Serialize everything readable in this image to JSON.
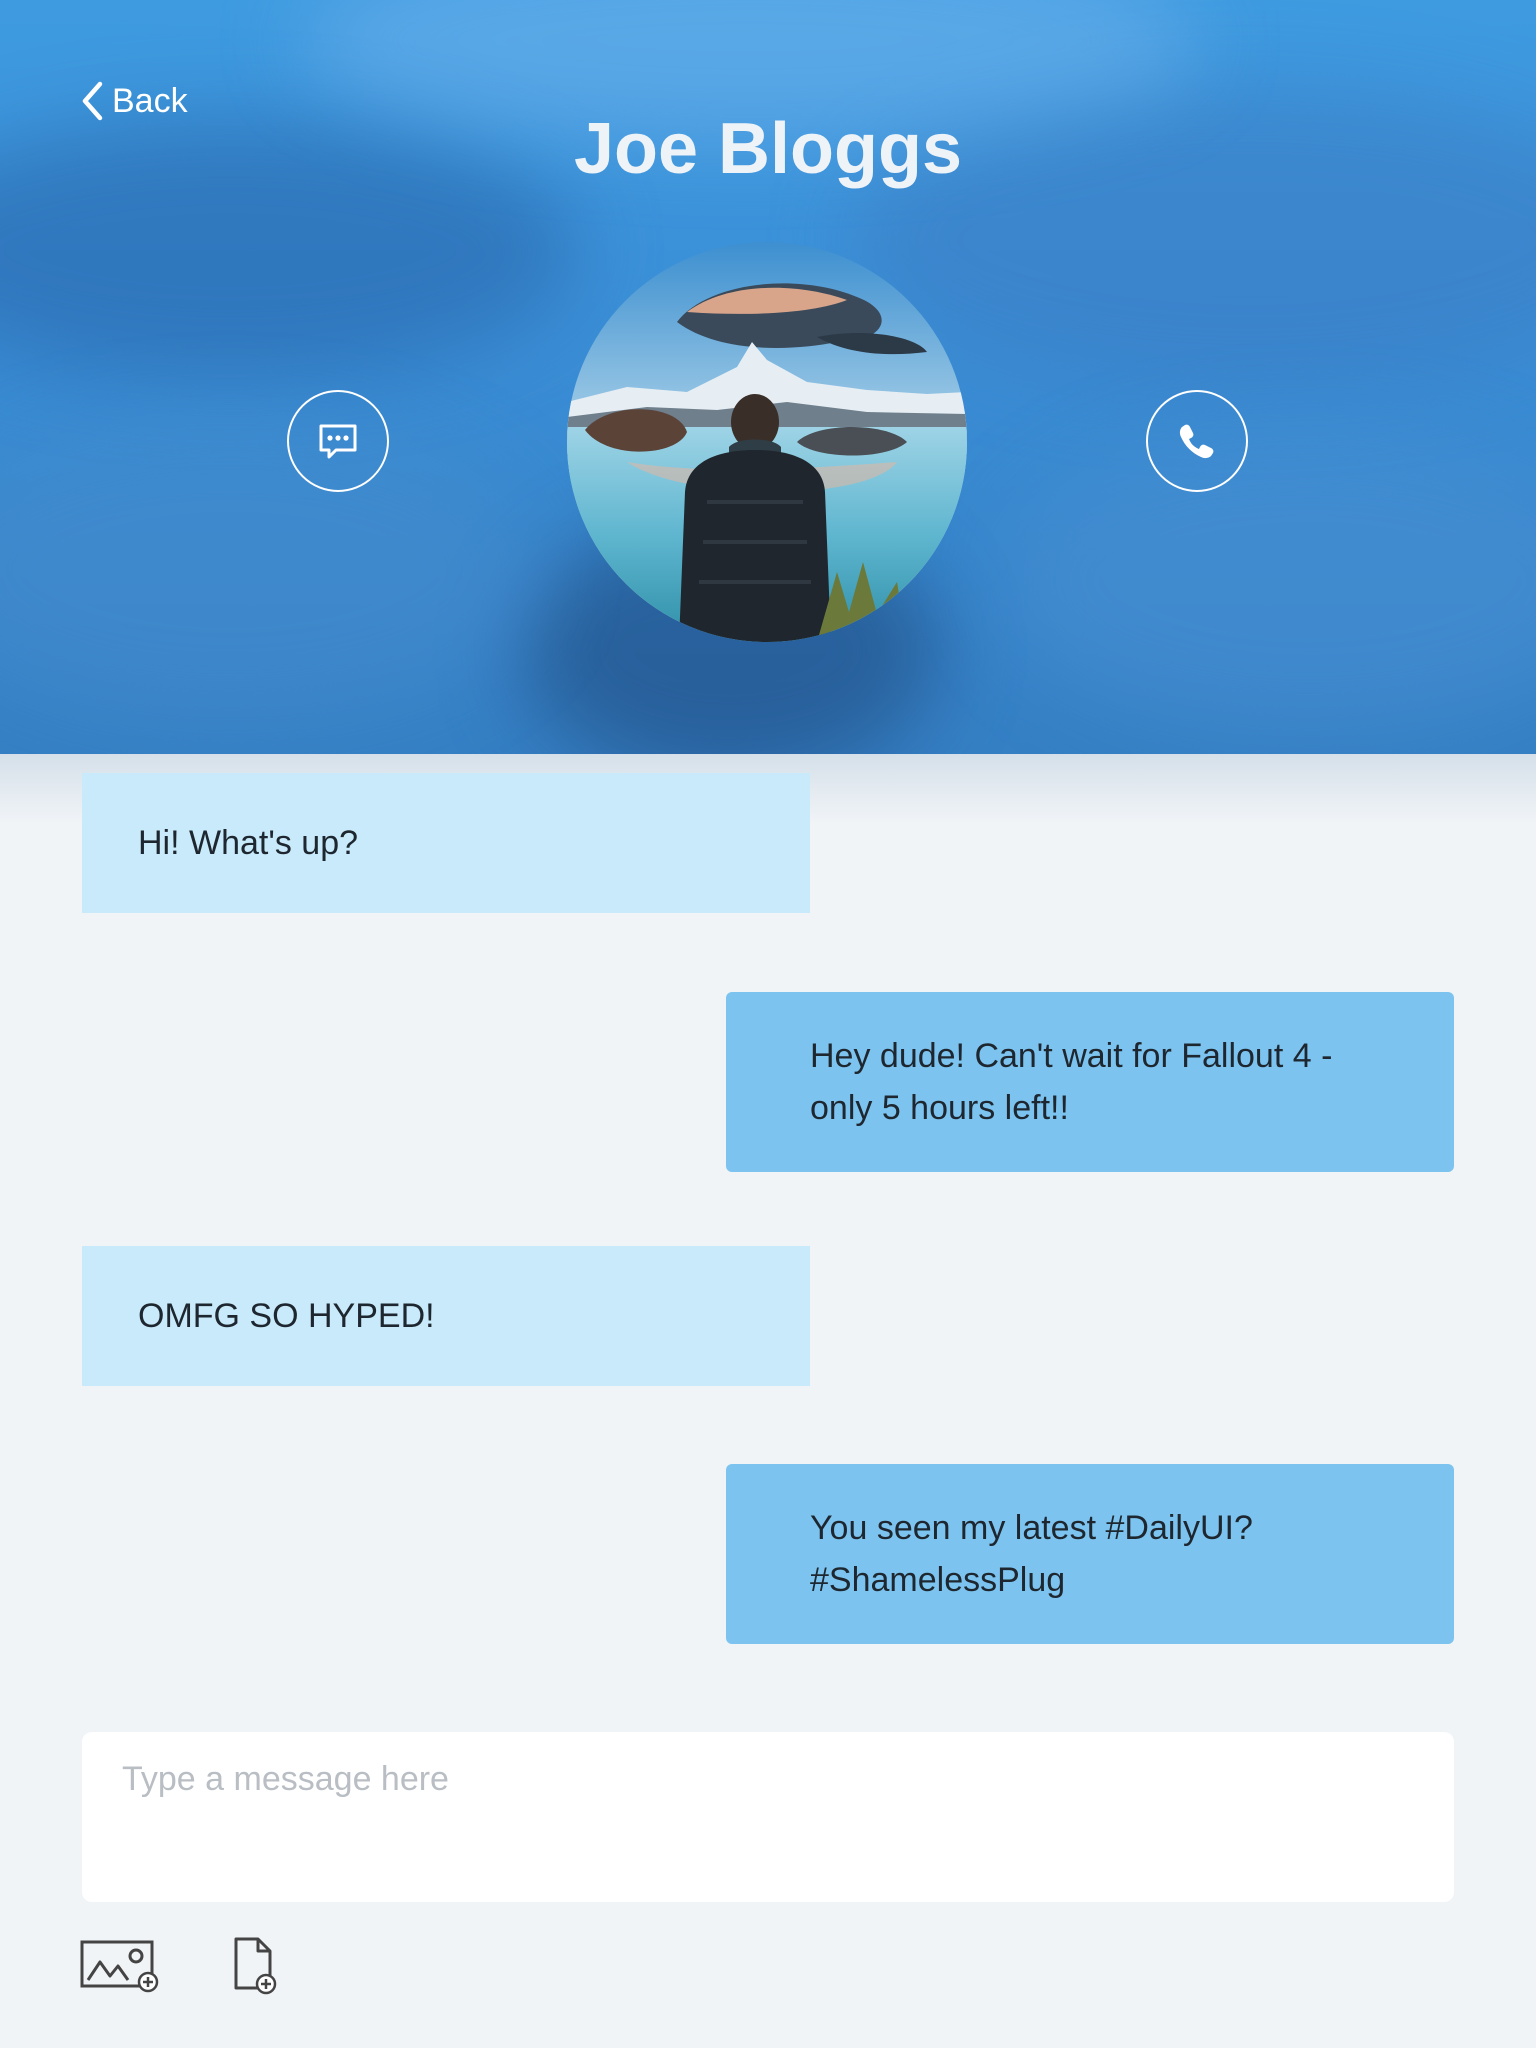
{
  "header": {
    "back_label": "Back",
    "contact_name": "Joe Bloggs",
    "background_color": "#3a8ed6"
  },
  "actions": {
    "message_icon": "chat-bubble-icon",
    "call_icon": "phone-icon"
  },
  "messages": [
    {
      "direction": "incoming",
      "text": "Hi! What's up?"
    },
    {
      "direction": "outgoing",
      "text": "Hey dude! Can't wait for Fallout 4 - only 5 hours left!!"
    },
    {
      "direction": "incoming",
      "text": "OMFG SO HYPED!"
    },
    {
      "direction": "outgoing",
      "text": "You seen my latest #DailyUI? #ShamelessPlug"
    }
  ],
  "colors": {
    "incoming_bubble": "#c8eafa",
    "outgoing_bubble": "#7cc4ef",
    "page_background": "#f1f4f7"
  },
  "composer": {
    "placeholder": "Type a message here",
    "value": ""
  },
  "attachments": {
    "image_icon": "add-image-icon",
    "file_icon": "add-file-icon"
  }
}
